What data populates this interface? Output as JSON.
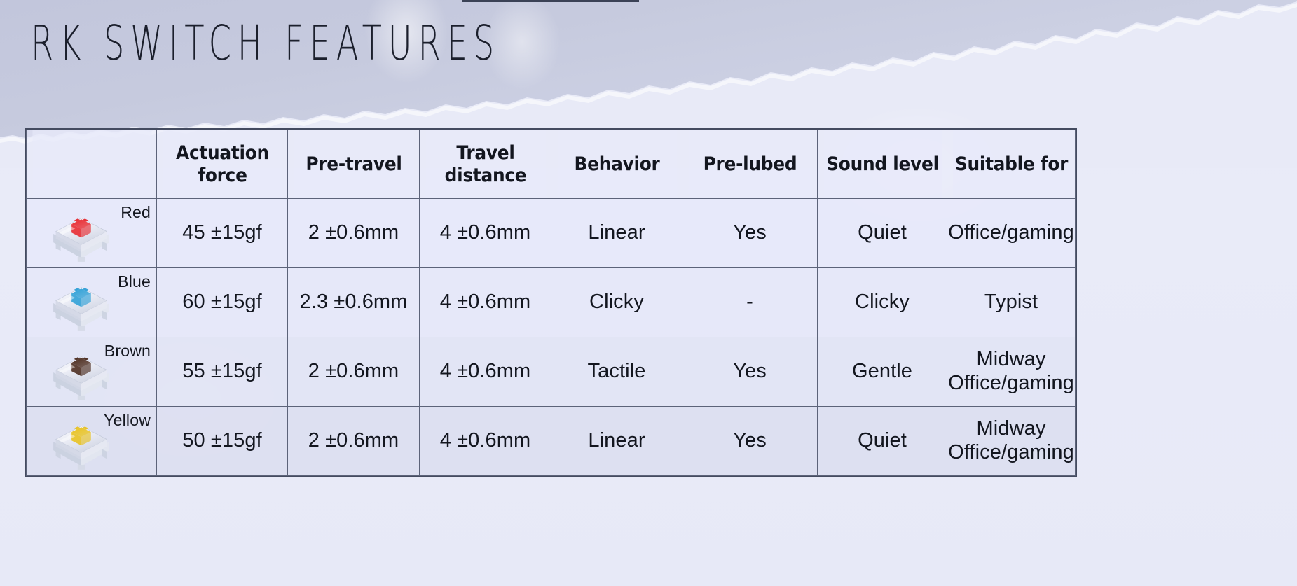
{
  "slide": {
    "title": "RK SWITCH FEATURES",
    "background_top_color": "#c6cade",
    "background_bottom_color": "#e8eaf7"
  },
  "table": {
    "headers": [
      "",
      "Actuation force",
      "Pre-travel",
      "Travel distance",
      "Behavior",
      "Pre-lubed",
      "Sound level",
      "Suitable for"
    ],
    "header_lines": {
      "actuation_force_l1": "Actuation",
      "actuation_force_l2": "force",
      "pre_travel": "Pre-travel",
      "travel_distance_l1": "Travel",
      "travel_distance_l2": "distance",
      "behavior": "Behavior",
      "pre_lubed": "Pre-lubed",
      "sound_level": "Sound level",
      "suitable_for": "Suitable for"
    },
    "rows": [
      {
        "switch_name": "Red",
        "switch_color": "#e8282e",
        "actuation_force": "45 ±15gf",
        "pre_travel": "2 ±0.6mm",
        "travel_distance": "4 ±0.6mm",
        "behavior": "Linear",
        "pre_lubed": "Yes",
        "sound_level": "Quiet",
        "suitable_for_l1": "Office/gaming",
        "suitable_for_l2": ""
      },
      {
        "switch_name": "Blue",
        "switch_color": "#2e9fd6",
        "actuation_force": "60 ±15gf",
        "pre_travel": "2.3 ±0.6mm",
        "travel_distance": "4 ±0.6mm",
        "behavior": "Clicky",
        "pre_lubed": "-",
        "sound_level": "Clicky",
        "suitable_for_l1": "Typist",
        "suitable_for_l2": ""
      },
      {
        "switch_name": "Brown",
        "switch_color": "#4a2a1c",
        "actuation_force": "55 ±15gf",
        "pre_travel": "2 ±0.6mm",
        "travel_distance": "4 ±0.6mm",
        "behavior": "Tactile",
        "pre_lubed": "Yes",
        "sound_level": "Gentle",
        "suitable_for_l1": "Midway",
        "suitable_for_l2": "Office/gaming"
      },
      {
        "switch_name": "Yellow",
        "switch_color": "#e8c11c",
        "actuation_force": "50 ±15gf",
        "pre_travel": "2 ±0.6mm",
        "travel_distance": "4 ±0.6mm",
        "behavior": "Linear",
        "pre_lubed": "Yes",
        "sound_level": "Quiet",
        "suitable_for_l1": "Midway",
        "suitable_for_l2": "Office/gaming"
      }
    ]
  }
}
